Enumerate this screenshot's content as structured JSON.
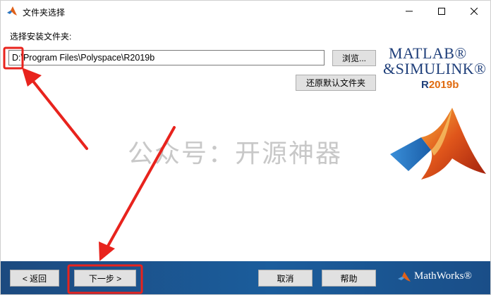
{
  "window": {
    "title": "文件夹选择"
  },
  "content": {
    "prompt": "选择安装文件夹:",
    "install_path": "D:\\Program Files\\Polyspace\\R2019b",
    "browse_label": "浏览...",
    "restore_label": "还原默认文件夹"
  },
  "logo": {
    "line1": "MATLAB®",
    "line2": "&SIMULINK®",
    "release_prefix": "R",
    "release_rest": "2019b"
  },
  "watermark": "公众号：开源神器",
  "footer": {
    "back_label": "< 返回",
    "next_label": "下一步 >",
    "cancel_label": "取消",
    "help_label": "帮助",
    "vendor": "MathWorks®"
  },
  "colors": {
    "annotation_red": "#e8231d",
    "footer_blue": "#1b5d9c",
    "logo_blue": "#1f3f7a",
    "logo_orange": "#e06b10"
  },
  "icons": {
    "app": "matlab-membrane-icon",
    "minimize": "minimize-icon",
    "maximize": "maximize-icon",
    "close": "close-icon",
    "vendor": "mathworks-membrane-icon"
  }
}
